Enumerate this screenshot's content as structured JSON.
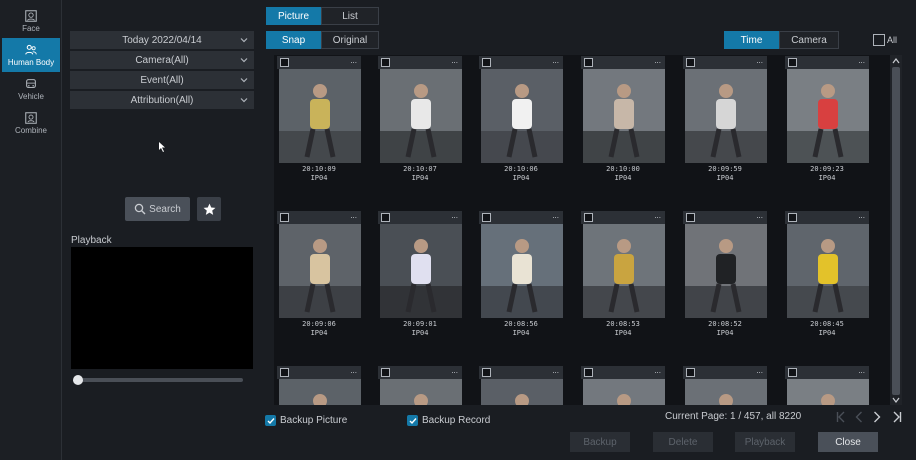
{
  "rail": {
    "items": [
      {
        "label": "Face",
        "icon": "face-icon"
      },
      {
        "label": "Human Body",
        "icon": "human-body-icon"
      },
      {
        "label": "Vehicle",
        "icon": "vehicle-icon"
      },
      {
        "label": "Combine",
        "icon": "combine-icon"
      }
    ],
    "active": "Human Body"
  },
  "filters": {
    "date": "Today 2022/04/14",
    "camera": "Camera(All)",
    "event": "Event(All)",
    "attribution": "Attribution(All)"
  },
  "search": {
    "label": "Search"
  },
  "playback": {
    "label": "Playback",
    "progress": 0
  },
  "view_tabs": {
    "picture": "Picture",
    "list": "List",
    "active": "Picture"
  },
  "image_tabs": {
    "snap": "Snap",
    "original": "Original",
    "active": "Snap"
  },
  "sort_tabs": {
    "time": "Time",
    "camera": "Camera",
    "active": "Time"
  },
  "select_all_label": "All",
  "cards": [
    {
      "time": "20:10:09",
      "camera": "IP04"
    },
    {
      "time": "20:10:07",
      "camera": "IP04"
    },
    {
      "time": "20:10:06",
      "camera": "IP04"
    },
    {
      "time": "20:10:00",
      "camera": "IP04"
    },
    {
      "time": "20:09:59",
      "camera": "IP04"
    },
    {
      "time": "20:09:23",
      "camera": "IP04"
    },
    {
      "time": "20:09:06",
      "camera": "IP04"
    },
    {
      "time": "20:09:01",
      "camera": "IP04"
    },
    {
      "time": "20:08:56",
      "camera": "IP04"
    },
    {
      "time": "20:08:53",
      "camera": "IP04"
    },
    {
      "time": "20:08:52",
      "camera": "IP04"
    },
    {
      "time": "20:08:45",
      "camera": "IP04"
    },
    {
      "time": "",
      "camera": ""
    },
    {
      "time": "",
      "camera": ""
    },
    {
      "time": "",
      "camera": ""
    },
    {
      "time": "",
      "camera": ""
    },
    {
      "time": "",
      "camera": ""
    },
    {
      "time": "",
      "camera": ""
    }
  ],
  "card_more_label": "...",
  "backup": {
    "picture_label": "Backup Picture",
    "record_label": "Backup Record"
  },
  "pagination": {
    "text": "Current Page: 1 / 457, all 8220"
  },
  "actions": {
    "backup": "Backup",
    "delete": "Delete",
    "playback": "Playback",
    "close": "Close"
  },
  "colors": {
    "accent": "#1479a8",
    "background": "#1a1d22",
    "panel": "#2c3036"
  }
}
